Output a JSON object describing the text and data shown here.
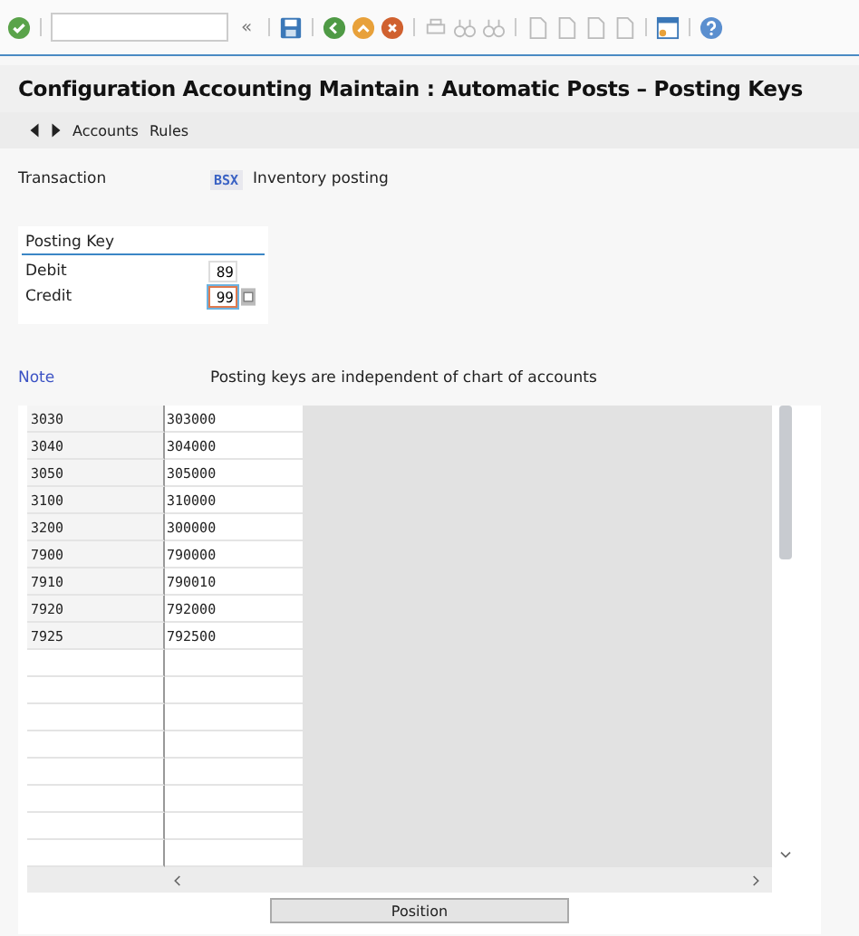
{
  "toolbar": {
    "collapse": "«"
  },
  "title": "Configuration Accounting Maintain : Automatic Posts – Posting Keys",
  "nav": {
    "links": [
      "Accounts",
      "Rules"
    ]
  },
  "transaction": {
    "label": "Transaction",
    "code": "BSX",
    "description": "Inventory posting"
  },
  "posting_key": {
    "heading": "Posting Key",
    "fields": [
      {
        "label": "Debit",
        "value": "89",
        "focused": false
      },
      {
        "label": "Credit",
        "value": "99",
        "focused": true
      }
    ]
  },
  "note": {
    "label": "Note",
    "text": "Posting keys are independent of chart of accounts"
  },
  "table": {
    "rows": [
      {
        "column_1": "3030",
        "column_2": "303000"
      },
      {
        "column_1": "3040",
        "column_2": "304000"
      },
      {
        "column_1": "3050",
        "column_2": "305000"
      },
      {
        "column_1": "3100",
        "column_2": "310000"
      },
      {
        "column_1": "3200",
        "column_2": "300000"
      },
      {
        "column_1": "7900",
        "column_2": "790000"
      },
      {
        "column_1": "7910",
        "column_2": "790010"
      },
      {
        "column_1": "7920",
        "column_2": "792000"
      },
      {
        "column_1": "7925",
        "column_2": "792500"
      }
    ]
  },
  "position_button": "Position"
}
